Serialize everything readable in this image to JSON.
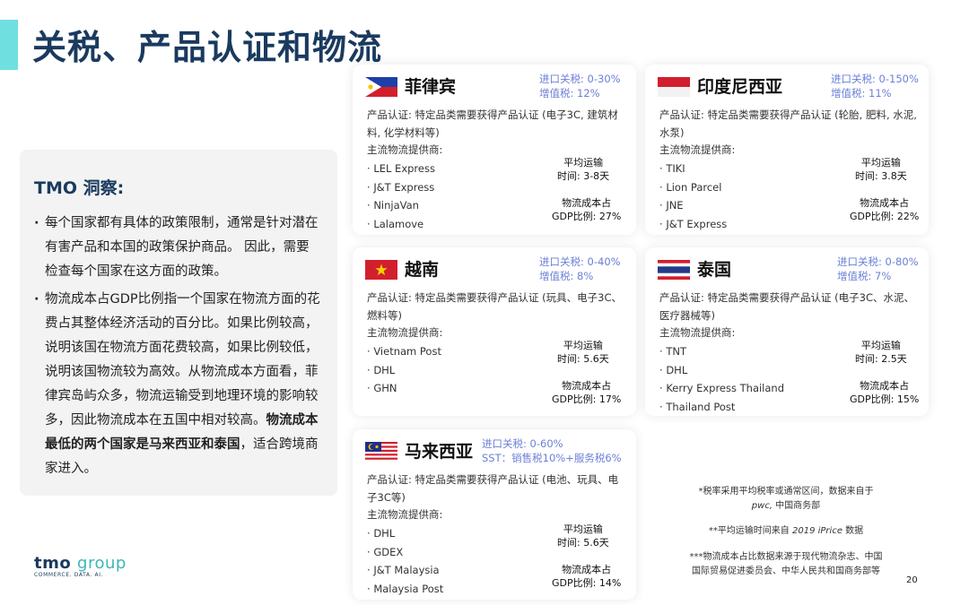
{
  "title": "关税、产品认证和物流",
  "insight": {
    "heading": "TMO 洞察:",
    "bullet1": "每个国家都有具体的政策限制，通常是针对潜在有害产品和本国的政策保护商品。 因此，需要检查每个国家在这方面的政策。",
    "bullet2_normal": "物流成本占GDP比例指一个国家在物流方面的花费占其整体经济活动的百分比。如果比例较高，说明该国在物流方面花费较高，如果比例较低，说明该国物流较为高效。从物流成本方面看，菲律宾岛屿众多，物流运输受到地理环境的影响较多，因此物流成本在五国中相对较高。",
    "bullet2_bold": "物流成本最低的两个国家是马来西亚和泰国",
    "bullet2_tail": "，适合跨境商家进入。"
  },
  "cards": {
    "ph": {
      "name": "菲律宾",
      "tax1": "进口关税: 0-30%",
      "tax2": "增值税: 12%",
      "cert": "产品认证: 特定品类需要获得产品认证 (电子3C, 建筑材料, 化学材料等)",
      "providers_label": "主流物流提供商:",
      "providers": [
        "LEL Express",
        "J&T Express",
        "NinjaVan",
        "Lalamove"
      ],
      "transit_label": "平均运输",
      "transit": "时间: 3-8天",
      "cost_label": "物流成本占",
      "cost": "GDP比例: 27%"
    },
    "id": {
      "name": "印度尼西亚",
      "tax1": "进口关税: 0-150%",
      "tax2": "增值税: 11%",
      "cert": "产品认证: 特定品类需要获得产品认证 (轮胎, 肥料, 水泥, 水泵)",
      "providers_label": "主流物流提供商:",
      "providers": [
        "TIKI",
        "Lion Parcel",
        "JNE",
        "J&T Express"
      ],
      "transit_label": "平均运输",
      "transit": "时间: 3.8天",
      "cost_label": "物流成本占",
      "cost": "GDP比例: 22%"
    },
    "vn": {
      "name": "越南",
      "tax1": "进口关税: 0-40%",
      "tax2": "增值税: 8%",
      "cert": "产品认证: 特定品类需要获得产品认证 (玩具、电子3C、燃料等)",
      "providers_label": "主流物流提供商:",
      "providers": [
        "Vietnam Post",
        "DHL",
        "GHN"
      ],
      "transit_label": "平均运输",
      "transit": "时间: 5.6天",
      "cost_label": "物流成本占",
      "cost": "GDP比例: 17%"
    },
    "th": {
      "name": "泰国",
      "tax1": "进口关税: 0-80%",
      "tax2": "增值税: 7%",
      "cert": "产品认证: 特定品类需要获得产品认证 (电子3C、水泥、医疗器械等)",
      "providers_label": "主流物流提供商:",
      "providers": [
        "TNT",
        "DHL",
        "Kerry Express Thailand",
        "Thailand Post"
      ],
      "transit_label": "平均运输",
      "transit": "时间: 2.5天",
      "cost_label": "物流成本占",
      "cost": "GDP比例: 15%"
    },
    "my": {
      "name": "马来西亚",
      "tax1": "进口关税: 0-60%",
      "tax2": "SST：销售税10%+服务税6%",
      "cert": "产品认证: 特定品类需要获得产品认证 (电池、玩具、电子3C等)",
      "providers_label": "主流物流提供商:",
      "providers": [
        "DHL",
        "GDEX",
        "J&T Malaysia",
        "Malaysia Post"
      ],
      "transit_label": "平均运输",
      "transit": "时间: 5.6天",
      "cost_label": "物流成本占",
      "cost": "GDP比例: 14%"
    }
  },
  "footnotes": {
    "n1_line1": "*税率采用平均税率或通常区间，数据来自于",
    "n1_line2_italic": "pwc,",
    "n1_line2_rest": " 中国商务部",
    "n2_pre": "**平均运输时间来自 ",
    "n2_italic": "2019 iPrice",
    "n2_post": " 数据",
    "n3_line1": "***物流成本占比数据来源于现代物流杂志、中国",
    "n3_line2": "国际贸易促进委员会、中华人民共和国商务部等"
  },
  "logo": {
    "main": "tmo",
    "main2": "group",
    "sub": "COMMERCE. DATA. AI."
  },
  "page_number": "20",
  "colors": {
    "accent": "#6fe0df",
    "title": "#1a3a5f",
    "tax": "#6a7fd6"
  }
}
